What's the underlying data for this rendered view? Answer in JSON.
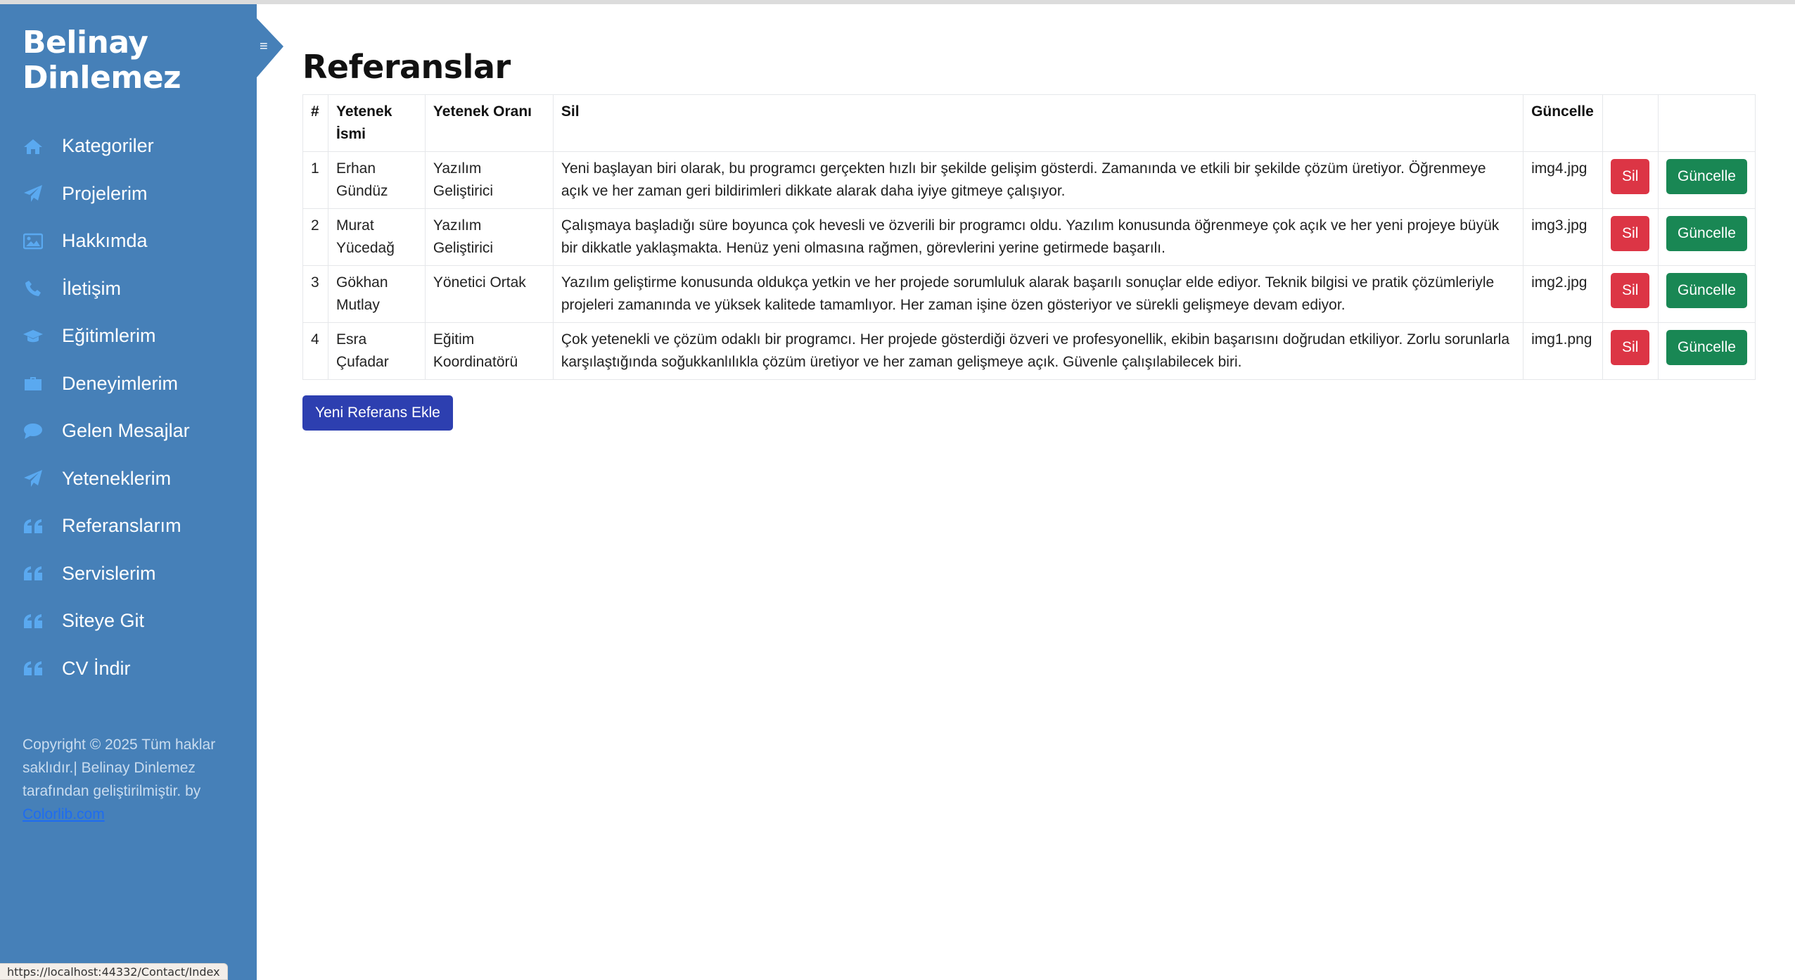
{
  "brand": {
    "line1": "Belinay",
    "line2": "Dinlemez"
  },
  "sidebar": {
    "items": [
      {
        "label": "Kategoriler",
        "icon": "home-icon"
      },
      {
        "label": "Projelerim",
        "icon": "paper-plane-icon"
      },
      {
        "label": "Hakkımda",
        "icon": "image-icon"
      },
      {
        "label": "İletişim",
        "icon": "phone-icon"
      },
      {
        "label": "Eğitimlerim",
        "icon": "graduation-cap-icon"
      },
      {
        "label": "Deneyimlerim",
        "icon": "briefcase-icon"
      },
      {
        "label": "Gelen Mesajlar",
        "icon": "comment-icon"
      },
      {
        "label": "Yeteneklerim",
        "icon": "paper-plane-icon"
      },
      {
        "label": "Referanslarım",
        "icon": "quote-icon"
      },
      {
        "label": "Servislerim",
        "icon": "quote-icon"
      },
      {
        "label": "Siteye Git",
        "icon": "quote-icon"
      },
      {
        "label": "CV İndir",
        "icon": "quote-icon"
      }
    ],
    "footer": {
      "text": "Copyright © 2025 Tüm haklar saklıdır.| Belinay Dinlemez tarafından geliştirilmiştir. by",
      "link": "Colorlib.com"
    }
  },
  "status_url": "https://localhost:44332/Contact/Index",
  "main": {
    "title": "Referanslar",
    "columns": [
      "#",
      "Yetenek İsmi",
      "Yetenek Oranı",
      "Sil",
      "Güncelle",
      ""
    ],
    "rows": [
      {
        "num": "1",
        "name": "Erhan Gündüz",
        "rate": "Yazılım Geliştirici",
        "desc": "Yeni başlayan biri olarak, bu programcı gerçekten hızlı bir şekilde gelişim gösterdi. Zamanında ve etkili bir şekilde çözüm üretiyor. Öğrenmeye açık ve her zaman geri bildirimleri dikkate alarak daha iyiye gitmeye çalışıyor.",
        "img": "img4.jpg"
      },
      {
        "num": "2",
        "name": "Murat Yücedağ",
        "rate": "Yazılım Geliştirici",
        "desc": "Çalışmaya başladığı süre boyunca çok hevesli ve özverili bir programcı oldu. Yazılım konusunda öğrenmeye çok açık ve her yeni projeye büyük bir dikkatle yaklaşmakta. Henüz yeni olmasına rağmen, görevlerini yerine getirmede başarılı.",
        "img": "img3.jpg"
      },
      {
        "num": "3",
        "name": "Gökhan Mutlay",
        "rate": "Yönetici Ortak",
        "desc": "Yazılım geliştirme konusunda oldukça yetkin ve her projede sorumluluk alarak başarılı sonuçlar elde ediyor. Teknik bilgisi ve pratik çözümleriyle projeleri zamanında ve yüksek kalitede tamamlıyor. Her zaman işine özen gösteriyor ve sürekli gelişmeye devam ediyor.",
        "img": "img2.jpg"
      },
      {
        "num": "4",
        "name": "Esra Çufadar",
        "rate": "Eğitim Koordinatörü",
        "desc": "Çok yetenekli ve çözüm odaklı bir programcı. Her projede gösterdiği özveri ve profesyonellik, ekibin başarısını doğrudan etkiliyor. Zorlu sorunlarla karşılaştığında soğukkanlılıkla çözüm üretiyor ve her zaman gelişmeye açık. Güvenle çalışılabilecek biri.",
        "img": "img1.png"
      }
    ],
    "delete_label": "Sil",
    "update_label": "Güncelle",
    "add_label": "Yeni Referans Ekle"
  },
  "colors": {
    "sidebar_bg": "#4680b8",
    "icon": "#5aa9f0",
    "delete": "#dc3545",
    "update": "#198754",
    "add": "#2d3fb0"
  }
}
